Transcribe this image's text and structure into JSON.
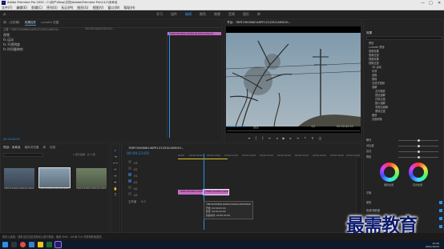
{
  "window": {
    "title": "Adobe Premiere Pro 2020 - C:\\用户\\Ebsp\\文档\\Adobe\\Premiere Pro\\14.0\\未命名",
    "controls": [
      "—",
      "□",
      "✕"
    ]
  },
  "menu": [
    "文件(F)",
    "编辑(E)",
    "剪辑(C)",
    "序列(S)",
    "标记(M)",
    "图形(G)",
    "视图(V)",
    "窗口(W)",
    "帮助(H)"
  ],
  "workspaces": {
    "home_icon": "home-icon",
    "tabs": [
      "学习",
      "组件",
      "编辑",
      "颜色",
      "效果",
      "音频",
      "图形",
      "库"
    ],
    "active": "编辑"
  },
  "source_panel": {
    "tabs": [
      "源：(无剪辑)",
      "效果控件",
      "Lumetri 范围"
    ],
    "active_tab": "效果控件",
    "source_line": "主要 * 78RTOHIOBW14KPE1Z1ZZ0CAMSOH...",
    "seq_line": "20210110/20210110...",
    "rows": [
      "视频",
      "fx  运动",
      "fx  不透明度",
      "fx  时间重映射"
    ],
    "clip_label": "78RTOHIOBW14KPE1Z1ZZ0CAMSOH...",
    "timecode": "00:00:00:00"
  },
  "program_monitor": {
    "title": "节目：78RTOHIOBW14KPE1Z1ZZ0CAMSOH...",
    "timecode_left": "00:00:23:05",
    "fit": "适合",
    "scale": "1/2",
    "timecode_right": "00:00:40:10",
    "controls": [
      "marker-icon",
      "in-point-icon",
      "out-point-icon",
      "go-to-in-icon",
      "step-back-icon",
      "play-icon",
      "step-forward-icon",
      "go-to-out-icon",
      "lift-icon",
      "extract-icon",
      "export-frame-icon"
    ]
  },
  "project_panel": {
    "tabs": [
      "项目：未命名",
      "媒体浏览器",
      "库",
      "信息"
    ],
    "active_tab": "项目：未命名",
    "search_placeholder": "",
    "item_count": "1 项已选择，共 3 项",
    "items": [
      {
        "name": "78RTOHIOBW14KPE1Z1ZZ0CAMSOH...",
        "dur": "5:00"
      },
      {
        "name": "78RTOHIOBW14KPE1Z1ZZ0CAMSOH...",
        "dur": "5:00"
      },
      {
        "name": "78RTOHIOBW14KPE1Z1ZZ0CAMSOH...",
        "dur": "5:00"
      }
    ]
  },
  "timeline": {
    "tab": "78RTOHIOBW14KPE1Z1ZZ0CAMSOH...",
    "timecode": "00:00:23:05",
    "ruler": [
      "00:00",
      "00:00:05:00",
      "00:00:10:00",
      "00:00:15:00",
      "00:00:20:00",
      "00:00:25:00",
      "00:00:30:00",
      "00:00:35:00",
      "00:00:40:00",
      "00:00:45:00",
      "00:00:50:00"
    ],
    "video_tracks": [
      "V3",
      "V2",
      "V1"
    ],
    "audio_tracks": [
      "A1",
      "A2",
      "A3"
    ],
    "master": "主声道",
    "master_value": "0.0",
    "clips": [
      {
        "label": "78RTOHIOBW14KPE1Z1ZZ0CAMSOH...",
        "start": 0,
        "end": 5
      },
      {
        "label": "78RTOHIOBW14KPE...",
        "start": 5,
        "end": 10
      }
    ],
    "tooltip": {
      "name": "78RTOHIOBW14KPE1Z1ZZ0CAMSOHN4SB.png",
      "start": "开始: 00:00:05:00",
      "end": "结束: 00:00:10:00",
      "duration": "持续时间: 00:00:05:00"
    }
  },
  "effects_panel": {
    "title": "效果",
    "folders": [
      "预设",
      "Lumetri 预设",
      "音频效果",
      "音频过渡",
      "视频效果",
      "视频过渡",
      "3D 运动",
      "内滑",
      "划像",
      "擦除",
      "沉浸式视频",
      "溶解",
      "缩放",
      "页面剥落"
    ],
    "sub_items": [
      "交叉缩放",
      "叠加溶解",
      "白场过渡",
      "胶片溶解",
      "非叠加溶解",
      "黑场过渡"
    ],
    "lumetri_rows": [
      "曝光",
      "对比度",
      "高光",
      "阴影",
      "白色",
      "黑色"
    ],
    "wheels": [
      "阴影色调",
      "高光色调"
    ],
    "balance": "平衡",
    "checks": [
      "晕影",
      "色调/饱和度",
      "HSL 辅助",
      "晕影"
    ]
  },
  "watermark": {
    "text": "最需教育"
  },
  "status_bar": {
    "text": "单击以选择，或单击空白处并拖动以进行框选。使用 Shift、Alt 和 Ctrl 可获得其他选项。"
  },
  "taskbar": {
    "time": "15:26",
    "date": "2021/10/25"
  },
  "colors": {
    "accent": "#2f8ee5",
    "clip": "#c66cc3",
    "playhead": "#2f8ee5"
  }
}
